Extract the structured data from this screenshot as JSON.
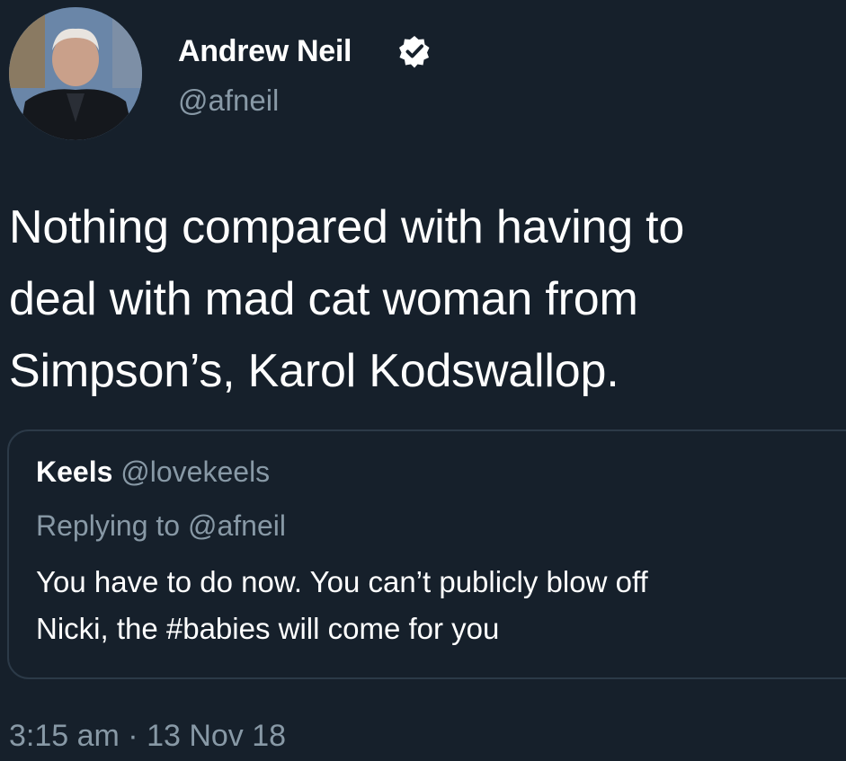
{
  "author": {
    "name": "Andrew Neil",
    "handle": "@afneil",
    "verified_icon": "verified-badge-icon"
  },
  "tweet": {
    "text_lines": [
      "Nothing compared with having to",
      "deal with mad cat woman from",
      "Simpson’s, Karol Kodswallop."
    ]
  },
  "quoted_tweet": {
    "author_name": "Keels",
    "author_handle": "@lovekeels",
    "replying_to": "Replying to @afneil",
    "text_lines": [
      "You have to do now. You can’t publicly blow off",
      "Nicki, the #babies will come for you"
    ]
  },
  "timestamp": "3:15 am · 13 Nov 18",
  "colors": {
    "background": "#16202b",
    "primary_text": "#ffffff",
    "secondary_text": "#8899a6",
    "border": "#2c3a48"
  }
}
